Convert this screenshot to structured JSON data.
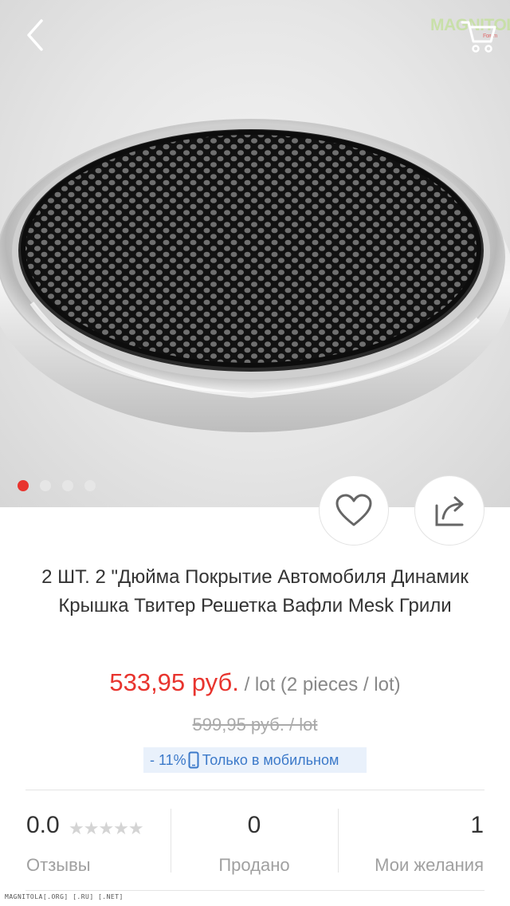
{
  "watermark": {
    "brand": "MAGNITOLA",
    "sub": "Forum"
  },
  "gallery": {
    "total": 4,
    "active": 1
  },
  "product": {
    "title": "2 ШТ. 2 \"Дюйма Покрытие Автомобиля Динамик Крышка Твитер Решетка Вафли Mesk Грили",
    "price": "533,95 руб.",
    "price_unit": " / lot (2 pieces / lot)",
    "old_price": "599,95 руб.  / lot",
    "promo_discount": "- 11%",
    "promo_text": "Только в мобильном"
  },
  "stats": {
    "rating_value": "0.0",
    "rating_stars": "★★★★★",
    "reviews_label": "Отзывы",
    "sold_value": "0",
    "sold_label": "Продано",
    "wishlist_value": "1",
    "wishlist_label": "Мои желания"
  },
  "footer": {
    "watermark_text": "MAGNITOLA[.ORG] [.RU] [.NET]"
  },
  "colors": {
    "accent": "#e8342e",
    "promo_bg": "#e9f1fb",
    "promo_text": "#3b79c9"
  },
  "icons": {
    "back": "chevron-left-icon",
    "cart": "cart-icon",
    "favorite": "heart-icon",
    "share": "share-icon",
    "phone": "phone-icon"
  }
}
